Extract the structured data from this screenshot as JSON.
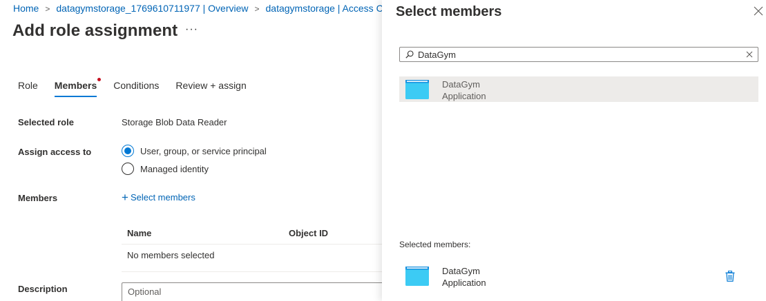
{
  "breadcrumb": {
    "items": [
      "Home",
      "datagymstorage_1769610711977 | Overview",
      "datagymstorage | Access Con"
    ]
  },
  "page": {
    "title": "Add role assignment",
    "more": "···"
  },
  "tabs": [
    "Role",
    "Members",
    "Conditions",
    "Review + assign"
  ],
  "form": {
    "selected_role_label": "Selected role",
    "selected_role_value": "Storage Blob Data Reader",
    "assign_access_label": "Assign access to",
    "assign_options": [
      "User, group, or service principal",
      "Managed identity"
    ],
    "members_label": "Members",
    "select_members_link": "Select members",
    "table_headers": [
      "Name",
      "Object ID"
    ],
    "table_empty": "No members selected",
    "description_label": "Description",
    "description_placeholder": "Optional"
  },
  "panel": {
    "title": "Select members",
    "search_value": "DataGym",
    "results": [
      {
        "name": "DataGym",
        "type": "Application"
      }
    ],
    "selected_label": "Selected members:",
    "selected": [
      {
        "name": "DataGym",
        "type": "Application"
      }
    ]
  },
  "colors": {
    "accent": "#0078d4",
    "link": "#0064b5",
    "required_dot": "#c50f1f",
    "app_icon": "#3ccbf4"
  },
  "icons": [
    "chevron-right-icon",
    "more-icon",
    "plus-icon",
    "close-icon",
    "search-icon",
    "clear-icon",
    "app-registration-icon",
    "trash-icon"
  ]
}
